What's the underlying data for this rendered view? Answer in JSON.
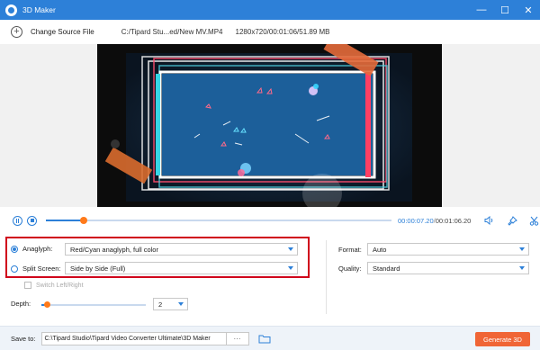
{
  "window": {
    "title": "3D Maker",
    "minimize_glyph": "—",
    "restore_glyph": "☐",
    "close_glyph": "✕"
  },
  "filebar": {
    "change_label": "Change Source File",
    "path": "C:/Tipard Stu...ed/New MV.MP4",
    "meta": "1280x720/00:01:06/51.89 MB"
  },
  "playback": {
    "current_time": "00:00:07.20",
    "separator": "/",
    "total_time": "00:01:06.20",
    "progress_fraction": 0.11
  },
  "anaglyph": {
    "label": "Anaglyph:",
    "value": "Red/Cyan anaglyph, full color",
    "selected": true
  },
  "split_screen": {
    "label": "Split Screen:",
    "value": "Side by Side (Full)",
    "selected": false
  },
  "switch_left_right": {
    "label": "Switch Left/Right",
    "checked": false,
    "enabled": false
  },
  "depth": {
    "label": "Depth:",
    "value": "2",
    "slider_fraction": 0.05
  },
  "format": {
    "label": "Format:",
    "value": "Auto"
  },
  "quality": {
    "label": "Quality:",
    "value": "Standard"
  },
  "save": {
    "label": "Save to:",
    "path": "C:\\Tipard Studio\\Tipard Video Converter Ultimate\\3D Maker",
    "browse_label": "···"
  },
  "generate_label": "Generate 3D",
  "colors": {
    "accent": "#2d80d8",
    "orange": "#ff7a1a",
    "generate_button": "#f06536",
    "highlight": "#d0021b"
  },
  "icons": [
    "app-logo-icon",
    "plus-circle-icon",
    "pause-icon",
    "stop-icon",
    "volume-icon",
    "pin-icon",
    "scissors-icon",
    "folder-icon"
  ]
}
